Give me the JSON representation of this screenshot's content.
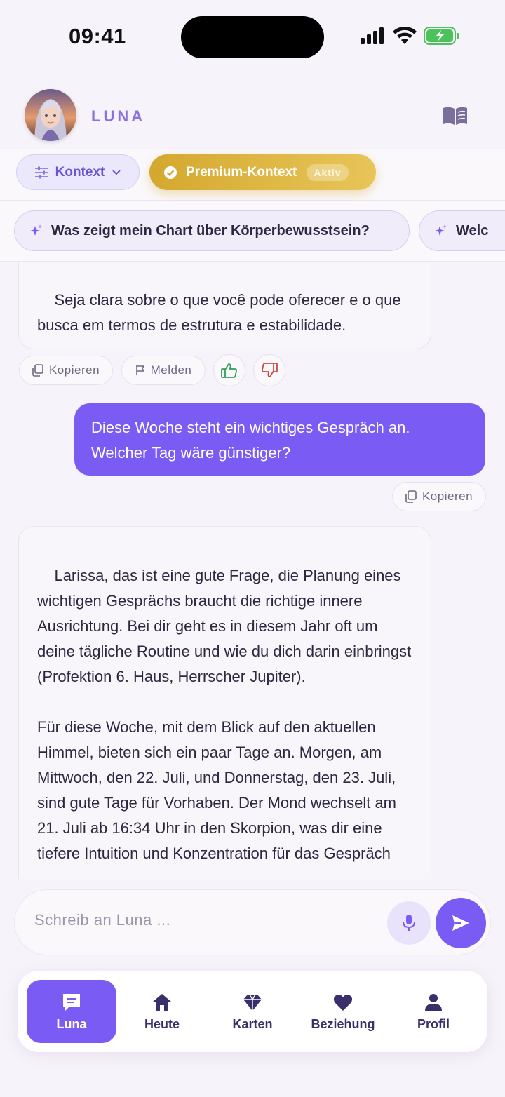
{
  "status": {
    "time": "09:41"
  },
  "header": {
    "app_name": "LUNA"
  },
  "context": {
    "kontext_label": "Kontext",
    "premium_label": "Premium-Kontext",
    "premium_badge": "Aktiv"
  },
  "suggestions": [
    {
      "label": "Was zeigt mein Chart über Körperbewusstsein?"
    },
    {
      "label": "Welc"
    }
  ],
  "messages": {
    "bot_1_text": "Seja clara sobre o que você pode oferecer e o que busca em termos de estrutura e estabilidade.",
    "copy_label": "Kopieren",
    "report_label": "Melden",
    "user_1_text": "Diese Woche steht ein wichtiges Gespräch an. Welcher Tag wäre günstiger?",
    "user_copy_label": "Kopieren",
    "bot_2_text": "Larissa, das ist eine gute Frage, die Planung eines wichtigen Gesprächs braucht die richtige innere Ausrichtung. Bei dir geht es in diesem Jahr oft um deine tägliche Routine und wie du dich darin einbringst (Profektion 6. Haus, Herrscher Jupiter).\n\nFür diese Woche, mit dem Blick auf den aktuellen Himmel, bieten sich ein paar Tage an. Morgen, am Mittwoch, den 22. Juli, und Donnerstag, den 23. Juli, sind gute Tage für Vorhaben. Der Mond wechselt am 21. Juli ab 16:34 Uhr in den Skorpion, was dir eine tiefere Intuition und Konzentration für das Gespräch"
  },
  "composer": {
    "placeholder": "Schreib an Luna ..."
  },
  "tabs": [
    {
      "label": "Luna",
      "icon": "chat-icon"
    },
    {
      "label": "Heute",
      "icon": "home-icon"
    },
    {
      "label": "Karten",
      "icon": "diamond-icon"
    },
    {
      "label": "Beziehung",
      "icon": "heart-icon"
    },
    {
      "label": "Profil",
      "icon": "person-icon"
    }
  ],
  "colors": {
    "accent": "#7a5cf5",
    "premium_gold": "#d4a82f",
    "background": "#f7f3fa",
    "thumb_up": "#2f9e5a",
    "thumb_down": "#d04848"
  }
}
